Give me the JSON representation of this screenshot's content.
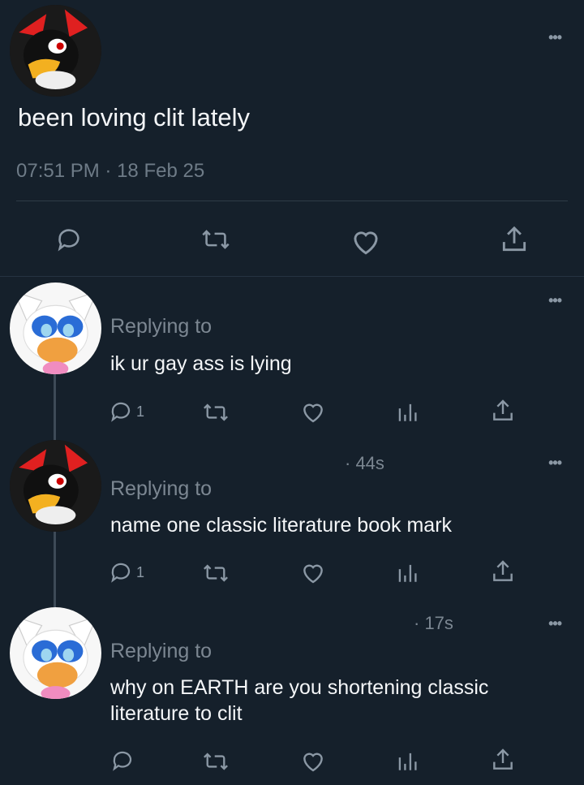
{
  "main_post": {
    "text": "been loving clit lately",
    "time": "07:51 PM",
    "separator": "·",
    "date": "18 Feb 25"
  },
  "more_label": "•••",
  "replies": [
    {
      "replying_label": "Replying to",
      "text": "ik ur gay ass is lying",
      "reply_count": "1",
      "timestamp": ""
    },
    {
      "replying_label": "Replying to",
      "text": "name one classic literature book mark",
      "reply_count": "1",
      "timestamp": "· 44s"
    },
    {
      "replying_label": "Replying to",
      "text_line1": "why on EARTH are you shortening classic",
      "text_line2": "literature to clit",
      "reply_count": "",
      "timestamp": "· 17s"
    }
  ],
  "icons": {
    "reply": "reply-bubble-icon",
    "retweet": "retweet-icon",
    "like": "heart-icon",
    "views": "analytics-icon",
    "share": "share-icon"
  },
  "colors": {
    "background": "#15202b",
    "text": "#f4f6f8",
    "muted": "#8b98a5",
    "divider": "#2f3b47"
  }
}
